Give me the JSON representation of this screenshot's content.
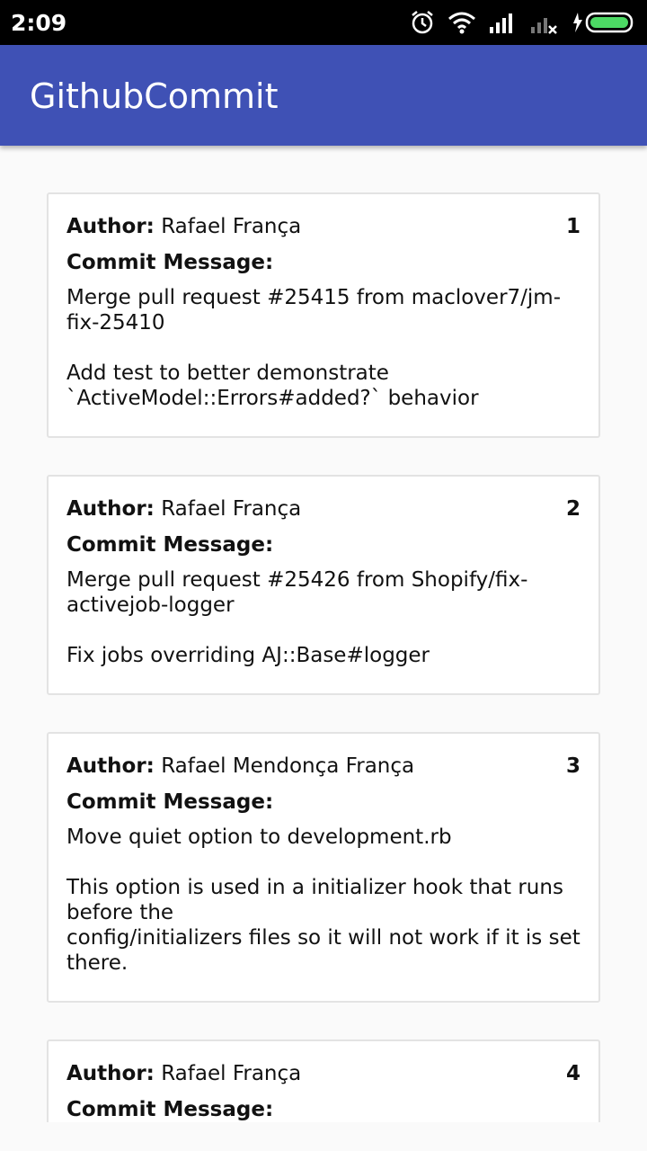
{
  "status_bar": {
    "time": "2:09"
  },
  "app_bar": {
    "title": "GithubCommit"
  },
  "labels": {
    "author": "Author:",
    "commit_message": "Commit Message:"
  },
  "commits": [
    {
      "index": "1",
      "author": "Rafael França",
      "message": "Merge pull request #25415 from maclover7/jm-\nfix-25410\n\nAdd test to better demonstrate\n`ActiveModel::Errors#added?` behavior"
    },
    {
      "index": "2",
      "author": "Rafael França",
      "message": "Merge pull request #25426 from Shopify/fix-\nactivejob-logger\n\nFix jobs overriding AJ::Base#logger"
    },
    {
      "index": "3",
      "author": "Rafael Mendonça França",
      "message": "Move quiet option to development.rb\n\nThis option is used in a initializer hook that runs\nbefore the\nconfig/initializers files so it will not work if it is set\nthere."
    },
    {
      "index": "4",
      "author": "Rafael França",
      "message": ""
    }
  ]
}
